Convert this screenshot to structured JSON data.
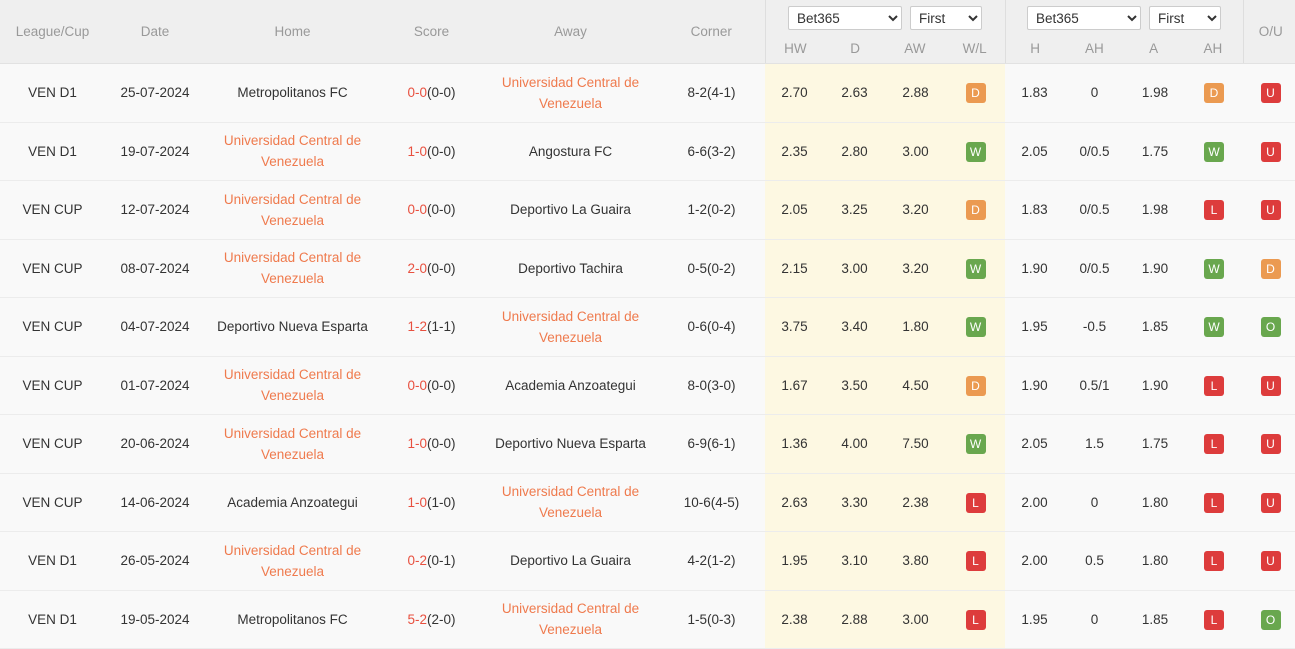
{
  "header": {
    "columns": [
      {
        "key": "league",
        "label": "League/Cup"
      },
      {
        "key": "date",
        "label": "Date"
      },
      {
        "key": "home",
        "label": "Home"
      },
      {
        "key": "score",
        "label": "Score"
      },
      {
        "key": "away",
        "label": "Away"
      },
      {
        "key": "corner",
        "label": "Corner"
      }
    ],
    "group1": {
      "bookmaker_selected": "Bet365",
      "bookmaker_options": [
        "Bet365"
      ],
      "half_selected": "First",
      "half_options": [
        "First"
      ],
      "sub_labels": [
        "HW",
        "D",
        "AW",
        "W/L"
      ]
    },
    "group2": {
      "bookmaker_selected": "Bet365",
      "bookmaker_options": [
        "Bet365"
      ],
      "half_selected": "First",
      "half_options": [
        "First"
      ],
      "sub_labels": [
        "H",
        "AH",
        "A",
        "AH"
      ]
    },
    "ou_label": "O/U"
  },
  "colors": {
    "highlight_team": "#ef7a4d",
    "score_main": "#e8503f",
    "row_highlight_band": "#fdf8e2",
    "badge_win": "#69a74e",
    "badge_draw": "#eb9a51",
    "badge_loss": "#dd3c3c",
    "badge_over": "#69a74e",
    "badge_under": "#dd3c3c",
    "header_bg": "#efefef"
  },
  "rows": [
    {
      "league": "VEN D1",
      "date": "25-07-2024",
      "home": "Metropolitanos FC",
      "home_highlight": false,
      "score_main": "0-0",
      "score_ht": "(0-0)",
      "away": "Universidad Central de Venezuela",
      "away_highlight": true,
      "corner": "8-2(4-1)",
      "hw": "2.70",
      "d": "2.63",
      "aw": "2.88",
      "wl": "D",
      "h": "1.83",
      "ah1": "0",
      "a": "1.98",
      "ah2": "D",
      "ou": "U"
    },
    {
      "league": "VEN D1",
      "date": "19-07-2024",
      "home": "Universidad Central de Venezuela",
      "home_highlight": true,
      "score_main": "1-0",
      "score_ht": "(0-0)",
      "away": "Angostura FC",
      "away_highlight": false,
      "corner": "6-6(3-2)",
      "hw": "2.35",
      "d": "2.80",
      "aw": "3.00",
      "wl": "W",
      "h": "2.05",
      "ah1": "0/0.5",
      "a": "1.75",
      "ah2": "W",
      "ou": "U"
    },
    {
      "league": "VEN CUP",
      "date": "12-07-2024",
      "home": "Universidad Central de Venezuela",
      "home_highlight": true,
      "score_main": "0-0",
      "score_ht": "(0-0)",
      "away": "Deportivo La Guaira",
      "away_highlight": false,
      "corner": "1-2(0-2)",
      "hw": "2.05",
      "d": "3.25",
      "aw": "3.20",
      "wl": "D",
      "h": "1.83",
      "ah1": "0/0.5",
      "a": "1.98",
      "ah2": "L",
      "ou": "U"
    },
    {
      "league": "VEN CUP",
      "date": "08-07-2024",
      "home": "Universidad Central de Venezuela",
      "home_highlight": true,
      "score_main": "2-0",
      "score_ht": "(0-0)",
      "away": "Deportivo Tachira",
      "away_highlight": false,
      "corner": "0-5(0-2)",
      "hw": "2.15",
      "d": "3.00",
      "aw": "3.20",
      "wl": "W",
      "h": "1.90",
      "ah1": "0/0.5",
      "a": "1.90",
      "ah2": "W",
      "ou": "D"
    },
    {
      "league": "VEN CUP",
      "date": "04-07-2024",
      "home": "Deportivo Nueva Esparta",
      "home_highlight": false,
      "score_main": "1-2",
      "score_ht": "(1-1)",
      "away": "Universidad Central de Venezuela",
      "away_highlight": true,
      "corner": "0-6(0-4)",
      "hw": "3.75",
      "d": "3.40",
      "aw": "1.80",
      "wl": "W",
      "h": "1.95",
      "ah1": "-0.5",
      "a": "1.85",
      "ah2": "W",
      "ou": "O"
    },
    {
      "league": "VEN CUP",
      "date": "01-07-2024",
      "home": "Universidad Central de Venezuela",
      "home_highlight": true,
      "score_main": "0-0",
      "score_ht": "(0-0)",
      "away": "Academia Anzoategui",
      "away_highlight": false,
      "corner": "8-0(3-0)",
      "hw": "1.67",
      "d": "3.50",
      "aw": "4.50",
      "wl": "D",
      "h": "1.90",
      "ah1": "0.5/1",
      "a": "1.90",
      "ah2": "L",
      "ou": "U"
    },
    {
      "league": "VEN CUP",
      "date": "20-06-2024",
      "home": "Universidad Central de Venezuela",
      "home_highlight": true,
      "score_main": "1-0",
      "score_ht": "(0-0)",
      "away": "Deportivo Nueva Esparta",
      "away_highlight": false,
      "corner": "6-9(6-1)",
      "hw": "1.36",
      "d": "4.00",
      "aw": "7.50",
      "wl": "W",
      "h": "2.05",
      "ah1": "1.5",
      "a": "1.75",
      "ah2": "L",
      "ou": "U"
    },
    {
      "league": "VEN CUP",
      "date": "14-06-2024",
      "home": "Academia Anzoategui",
      "home_highlight": false,
      "score_main": "1-0",
      "score_ht": "(1-0)",
      "away": "Universidad Central de Venezuela",
      "away_highlight": true,
      "corner": "10-6(4-5)",
      "hw": "2.63",
      "d": "3.30",
      "aw": "2.38",
      "wl": "L",
      "h": "2.00",
      "ah1": "0",
      "a": "1.80",
      "ah2": "L",
      "ou": "U"
    },
    {
      "league": "VEN D1",
      "date": "26-05-2024",
      "home": "Universidad Central de Venezuela",
      "home_highlight": true,
      "score_main": "0-2",
      "score_ht": "(0-1)",
      "away": "Deportivo La Guaira",
      "away_highlight": false,
      "corner": "4-2(1-2)",
      "hw": "1.95",
      "d": "3.10",
      "aw": "3.80",
      "wl": "L",
      "h": "2.00",
      "ah1": "0.5",
      "a": "1.80",
      "ah2": "L",
      "ou": "U"
    },
    {
      "league": "VEN D1",
      "date": "19-05-2024",
      "home": "Metropolitanos FC",
      "home_highlight": false,
      "score_main": "5-2",
      "score_ht": "(2-0)",
      "away": "Universidad Central de Venezuela",
      "away_highlight": true,
      "corner": "1-5(0-3)",
      "hw": "2.38",
      "d": "2.88",
      "aw": "3.00",
      "wl": "L",
      "h": "1.95",
      "ah1": "0",
      "a": "1.85",
      "ah2": "L",
      "ou": "O"
    }
  ]
}
